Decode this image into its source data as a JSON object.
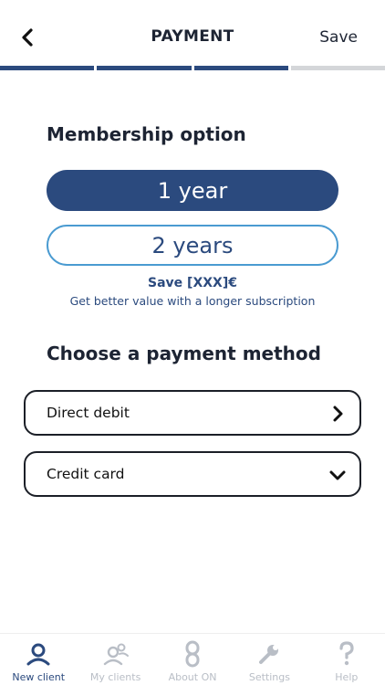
{
  "header": {
    "title": "PAYMENT",
    "save_label": "Save"
  },
  "progress": {
    "total_steps": 4,
    "completed_steps": 3
  },
  "membership": {
    "title": "Membership option",
    "options": [
      {
        "label": "1 year",
        "selected": true
      },
      {
        "label": "2 years",
        "selected": false
      }
    ],
    "save_text": "Save [XXX]€",
    "value_text": "Get better value with a longer subscription"
  },
  "payment": {
    "title": "Choose a payment method",
    "methods": [
      {
        "label": "Direct debit",
        "icon": "chevron-right-icon"
      },
      {
        "label": "Credit card",
        "icon": "chevron-down-icon"
      }
    ]
  },
  "tabbar": {
    "items": [
      {
        "label": "New client",
        "icon": "person-icon",
        "active": true
      },
      {
        "label": "My clients",
        "icon": "people-icon",
        "active": false
      },
      {
        "label": "About ON",
        "icon": "link-icon",
        "active": false
      },
      {
        "label": "Settings",
        "icon": "wrench-icon",
        "active": false
      },
      {
        "label": "Help",
        "icon": "question-icon",
        "active": false
      }
    ]
  },
  "colors": {
    "primary": "#2b4a7e",
    "outline_accent": "#4a9bd1",
    "inactive": "#b9bec6",
    "progress_track": "#d4d6d9"
  }
}
